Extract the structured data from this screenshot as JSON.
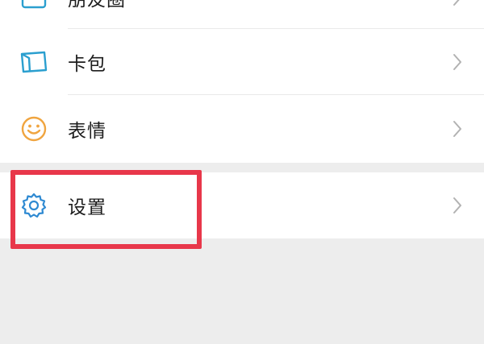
{
  "menu": {
    "partial_label": "朋友圈",
    "items": [
      {
        "label": "卡包",
        "icon": "card-icon",
        "icon_color": "#2b9fcf"
      },
      {
        "label": "表情",
        "icon": "smiley-icon",
        "icon_color": "#f0a540"
      },
      {
        "label": "设置",
        "icon": "gear-icon",
        "icon_color": "#2f8ad2"
      }
    ]
  },
  "colors": {
    "highlight": "#e8374a",
    "page_background": "#ededed",
    "row_background": "#ffffff",
    "chevron": "#b2b2b2"
  }
}
